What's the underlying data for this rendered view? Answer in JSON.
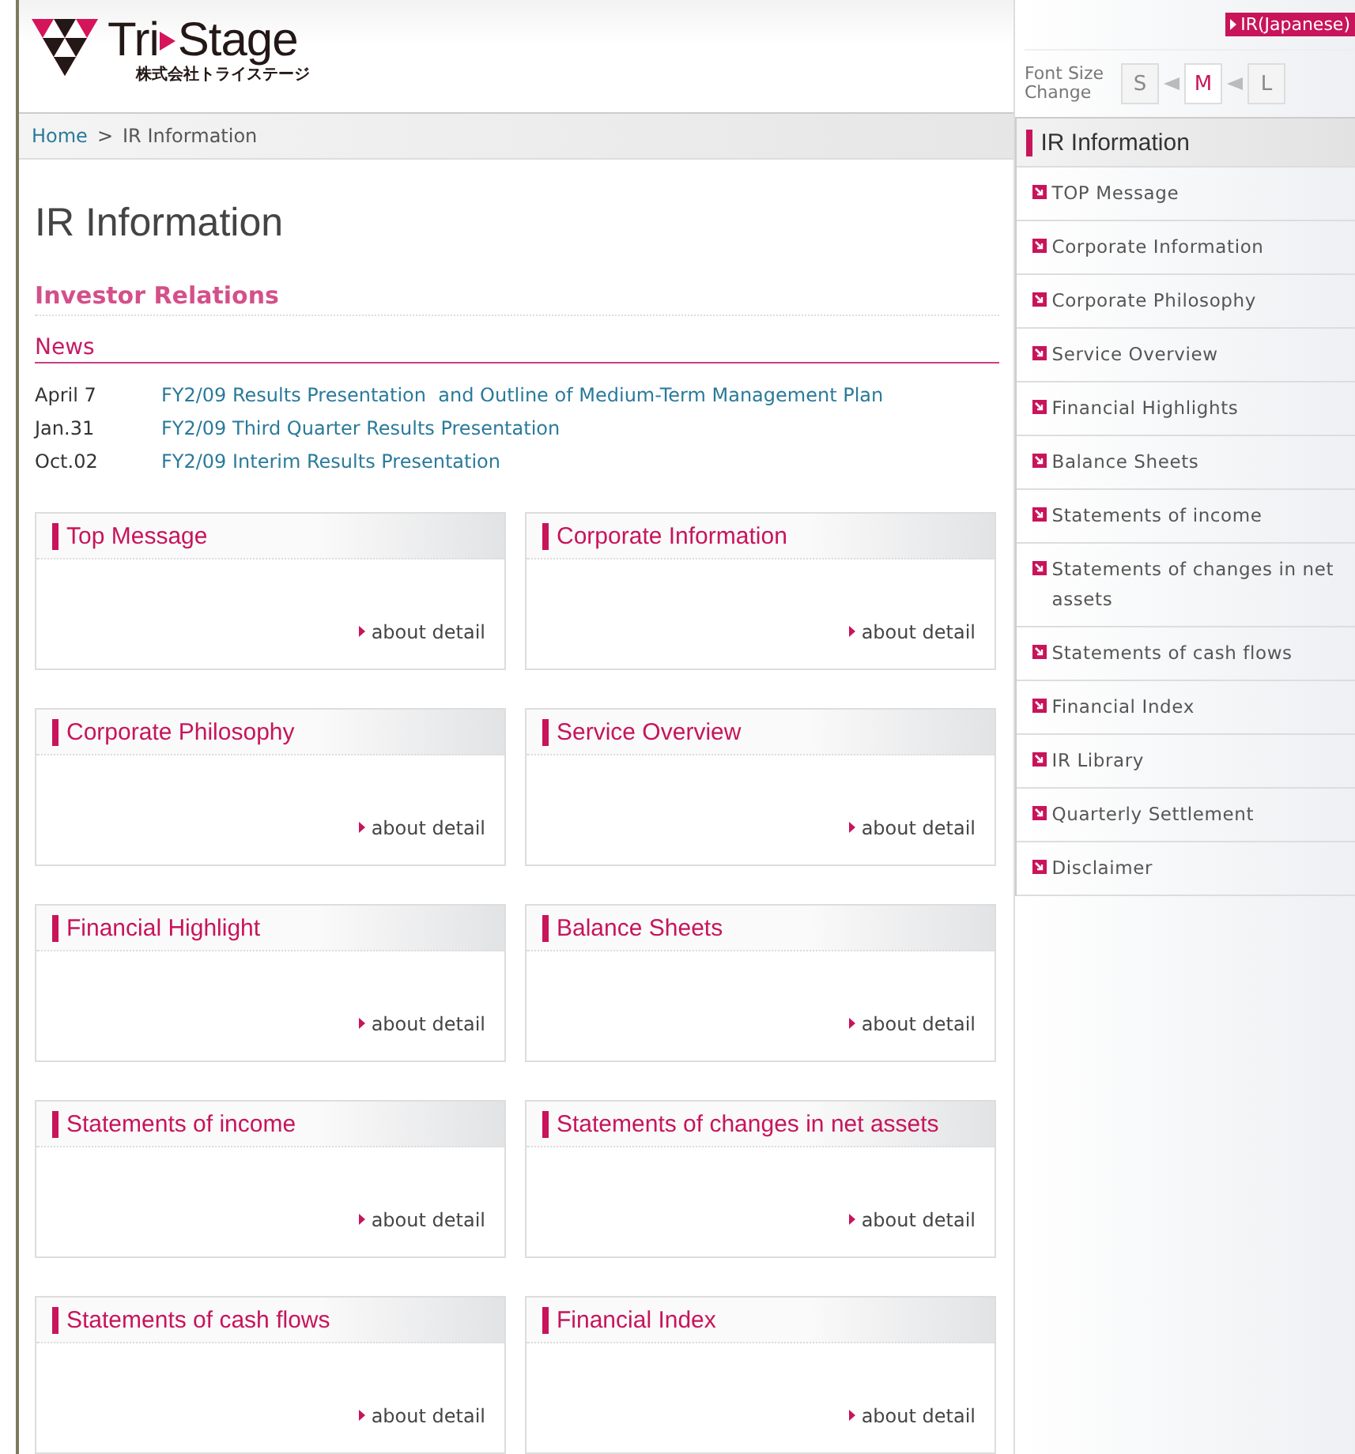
{
  "header": {
    "logo": {
      "name_start": "Tri",
      "name_end": "Stage",
      "subtitle": "株式会社トライステージ"
    },
    "language_link": "IR(Japanese)",
    "font_size": {
      "label": "Font Size Change",
      "options": [
        {
          "label": "S",
          "selected": false
        },
        {
          "label": "M",
          "selected": true
        },
        {
          "label": "L",
          "selected": false
        }
      ]
    }
  },
  "breadcrumb": [
    {
      "label": "Home",
      "link": true
    },
    {
      "label": ">",
      "link": false
    },
    {
      "label": "IR Information",
      "link": false
    }
  ],
  "page_title": "IR Information",
  "section_title": "Investor Relations",
  "news": {
    "title": "News",
    "items": [
      {
        "date": "April 7",
        "title": "FY2/09 Results Presentation  and Outline of Medium-Term Management Plan"
      },
      {
        "date": "Jan.31",
        "title": "FY2/09 Third Quarter Results Presentation"
      },
      {
        "date": "Oct.02",
        "title": "FY2/09 Interim Results Presentation"
      }
    ]
  },
  "cards": [
    {
      "title": "Top Message",
      "link": "about detail"
    },
    {
      "title": "Corporate Information",
      "link": "about detail"
    },
    {
      "title": "Corporate Philosophy",
      "link": "about detail"
    },
    {
      "title": "Service Overview",
      "link": "about detail"
    },
    {
      "title": "Financial Highlight",
      "link": "about detail"
    },
    {
      "title": "Balance Sheets",
      "link": "about detail"
    },
    {
      "title": "Statements of income",
      "link": "about detail"
    },
    {
      "title": "Statements of changes in net assets",
      "link": "about detail"
    },
    {
      "title": "Statements of cash flows",
      "link": "about detail"
    },
    {
      "title": "Financial Index",
      "link": "about detail"
    }
  ],
  "sidebar": {
    "title": "IR Information",
    "items": [
      "TOP Message",
      "Corporate Information",
      "Corporate Philosophy",
      "Service Overview",
      "Financial Highlights",
      "Balance Sheets",
      "Statements of income",
      "Statements of changes in net assets",
      "Statements of cash flows",
      "Financial Index",
      "IR Library",
      "Quarterly Settlement",
      "Disclaimer"
    ]
  }
}
